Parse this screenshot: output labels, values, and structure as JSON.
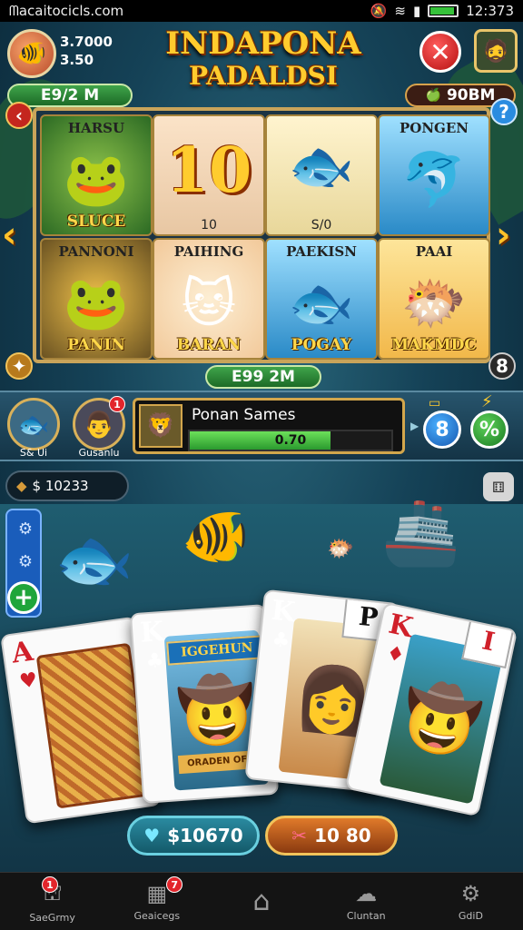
{
  "status_bar": {
    "carrier": "ᗰacaitocicls.com",
    "time": "12:373"
  },
  "header": {
    "coins_line1": "3.7000",
    "coins_line2": "3.50",
    "title_line1": "INDAPONA",
    "title_line2": "PADALDSI",
    "pill_left": "E9/2 M",
    "pill_right": "90BM"
  },
  "board": {
    "tiles": [
      {
        "top": "HARSU",
        "bottom": "SLUCE",
        "icon": "frog"
      },
      {
        "big": "10",
        "small": "10",
        "icon": "ten"
      },
      {
        "small": "S/0",
        "icon": "green-fish"
      },
      {
        "top": "PONGEN",
        "icon": "blue-fish"
      },
      {
        "top": "PANNONI",
        "bottom": "PANIN",
        "icon": "frog"
      },
      {
        "top": "PAIHING",
        "bottom": "BARAN",
        "icon": "cat"
      },
      {
        "top": "PAEKISN",
        "bottom": "POGAY",
        "icon": "green-fish"
      },
      {
        "top": "PAAI",
        "bottom": "MAKMDC",
        "icon": "red-fish"
      }
    ],
    "corner_right": "8",
    "total_pill": "E99 2M"
  },
  "players": {
    "p1_name": "S& Ui",
    "p2_name": "Gusanlu",
    "p2_badge": "1",
    "panel_name": "Ponan Sames",
    "progress_text": "0.70",
    "progress_fraction": 0.7,
    "btn_blue": "8",
    "btn_green": "%"
  },
  "balance": {
    "text": "$ 10233"
  },
  "cards": [
    {
      "rank": "A",
      "suit": "♥",
      "color": "#d0202a"
    },
    {
      "rank": "K",
      "suit": "♣",
      "color": "#111",
      "banner": "IGGEHUN",
      "banner2": "ORADEN OFER"
    },
    {
      "rank": "K",
      "suit": "♣",
      "color": "#111",
      "tag": "P"
    },
    {
      "rank": "K",
      "suit": "♦",
      "color": "#d0202a",
      "tag": "I"
    }
  ],
  "bottom_pills": {
    "left": "$10670",
    "right": "10 80"
  },
  "bottom_nav": [
    {
      "label": "SaeGrmy",
      "icon": "cannon",
      "badge": "1"
    },
    {
      "label": "Geaicegs",
      "icon": "grid",
      "badge": "7"
    },
    {
      "label": "",
      "icon": "home"
    },
    {
      "label": "Cluntan",
      "icon": "chat"
    },
    {
      "label": "GdiD",
      "icon": "gear"
    }
  ],
  "colors": {
    "accent_gold": "#ffcc2e",
    "green": "#2a9a2e",
    "red": "#d0202a"
  }
}
